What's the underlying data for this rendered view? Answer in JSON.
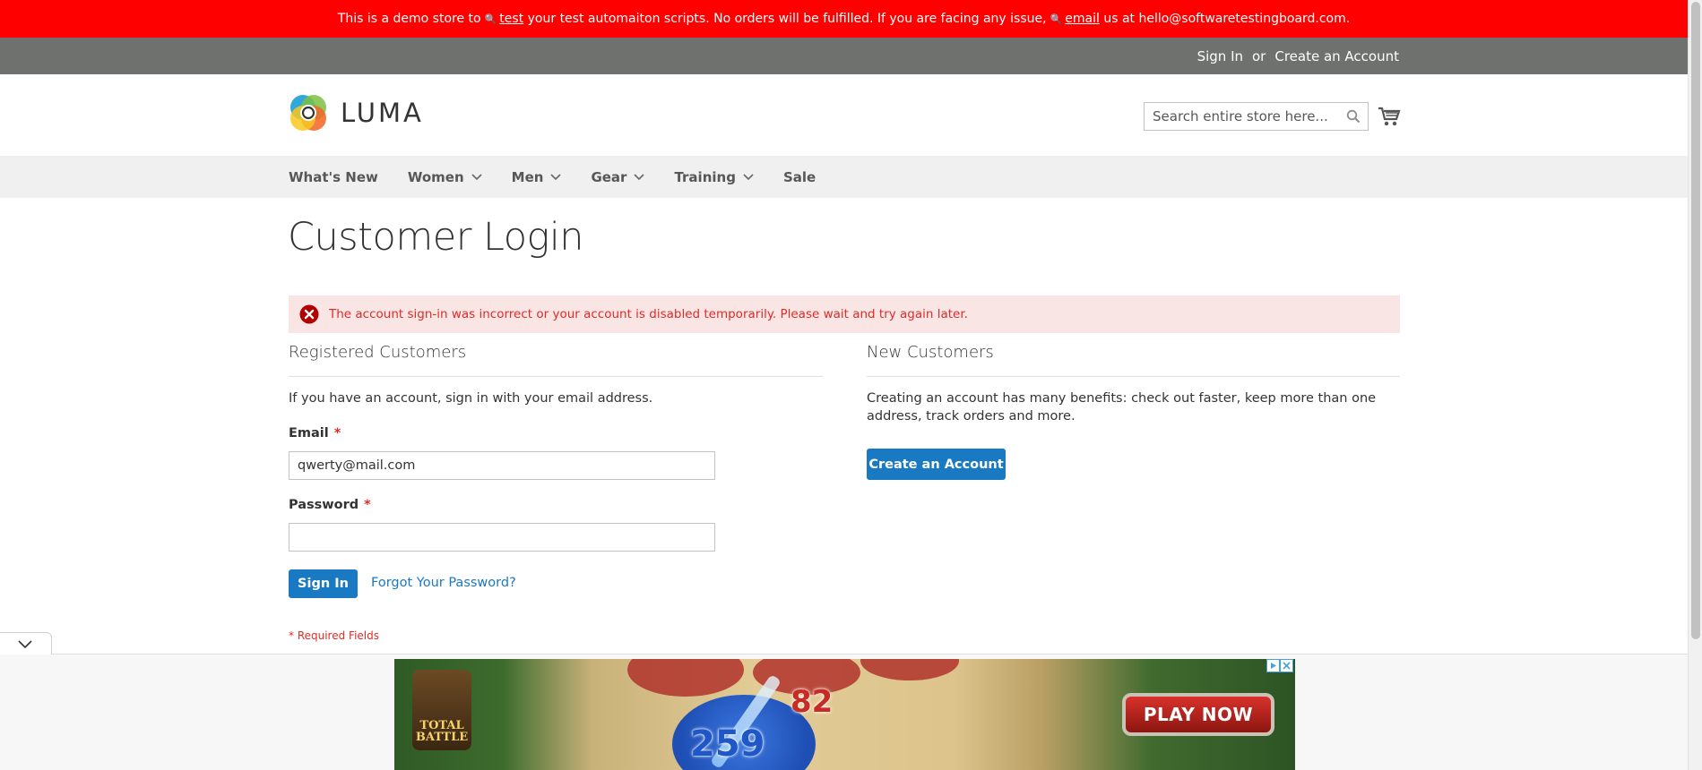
{
  "banner": {
    "text_1": "This is a demo store to",
    "link_1": "test",
    "text_2": "your test automaiton scripts. No orders will be fulfilled. If you are facing any issue,",
    "link_2": "email",
    "text_3": "us at hello@softwaretestingboard.com.",
    "bg_color": "#ff0000"
  },
  "top_links": {
    "sign_in": "Sign In",
    "or": "or",
    "create_account": "Create an Account"
  },
  "header": {
    "logo_text": "LUMA",
    "search_placeholder": "Search entire store here...",
    "search_value": "",
    "cart_icon": "cart-icon"
  },
  "nav": {
    "items": [
      {
        "label": "What's New",
        "has_dropdown": false
      },
      {
        "label": "Women",
        "has_dropdown": true
      },
      {
        "label": "Men",
        "has_dropdown": true
      },
      {
        "label": "Gear",
        "has_dropdown": true
      },
      {
        "label": "Training",
        "has_dropdown": true
      },
      {
        "label": "Sale",
        "has_dropdown": false
      }
    ]
  },
  "page": {
    "title": "Customer Login",
    "error": "The account sign-in was incorrect or your account is disabled temporarily. Please wait and try again later."
  },
  "registered": {
    "title": "Registered Customers",
    "intro": "If you have an account, sign in with your email address.",
    "email_label": "Email",
    "email_value": "qwerty@mail.com",
    "password_label": "Password",
    "password_value": "",
    "required_mark": "*",
    "sign_in_button": "Sign In",
    "forgot_link": "Forgot Your Password?",
    "required_note": "* Required Fields"
  },
  "new_customers": {
    "title": "New Customers",
    "intro": "Creating an account has many benefits: check out faster, keep more than one address, track orders and more.",
    "create_button": "Create an Account"
  },
  "ad": {
    "brand": "TOTAL BATTLE",
    "num_blue": "259",
    "num_red": "82",
    "cta": "PLAY NOW"
  },
  "colors": {
    "accent": "#1979c3",
    "error_text": "#e02b27",
    "error_bg": "#fae5e5",
    "top_links_bg": "#6e716e",
    "nav_bg": "#f0f0f0"
  }
}
